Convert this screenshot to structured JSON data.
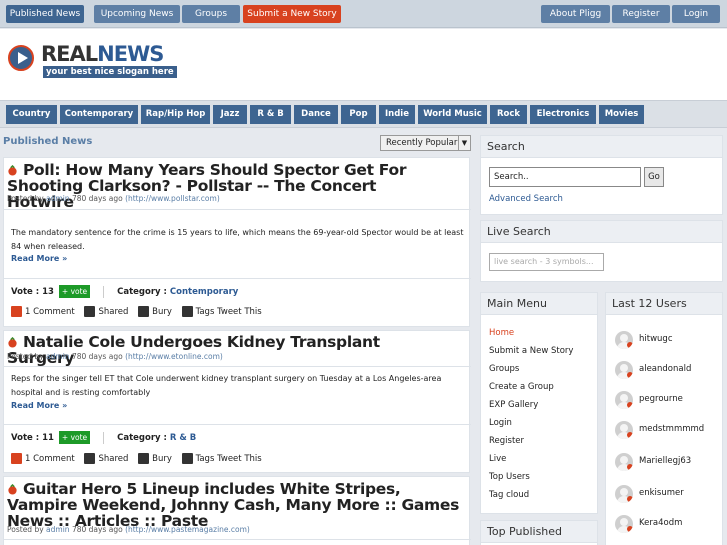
{
  "topnav": {
    "left": [
      "Published News",
      "Upcoming News",
      "Groups",
      "Submit a New Story"
    ],
    "right": [
      "About Pligg",
      "Register",
      "Login"
    ]
  },
  "logo": {
    "real": "REAL",
    "news": "NEWS",
    "slogan": "your best nice slogan here"
  },
  "categories": [
    "Country",
    "Contemporary",
    "Rap/Hip Hop",
    "Jazz",
    "R & B",
    "Dance",
    "Pop",
    "Indie",
    "World Music",
    "Rock",
    "Electronics",
    "Movies"
  ],
  "main": {
    "title": "Published News",
    "sort": "Recently Popular"
  },
  "stories": [
    {
      "title": "Poll: How Many Years Should Spector Get For Shooting Clarkson? - Pollstar -- The Concert Hotwire",
      "posted_by": "Posted by",
      "author": "admin",
      "age": "780 days ago",
      "source": "(http://www.pollstar.com)",
      "content": "The mandatory sentence for the crime is 15 years to life, which means the 69-year-old Spector would be at least 84 when released.",
      "readmore": "Read More »",
      "vote_label": "Vote :",
      "votes": "13",
      "vote_btn": "+ vote",
      "category_label": "Category :",
      "category": "Contemporary",
      "comments": "1 Comment",
      "shared": "Shared",
      "bury": "Bury",
      "tags": "Tags Tweet This"
    },
    {
      "title": "Natalie Cole Undergoes Kidney Transplant Surgery",
      "posted_by": "Posted by",
      "author": "admin",
      "age": "780 days ago",
      "source": "(http://www.etonline.com)",
      "content": "Reps for the singer tell ET that Cole underwent kidney transplant surgery on Tuesday at a Los Angeles-area hospital and is resting comfortably",
      "readmore": "Read More »",
      "vote_label": "Vote :",
      "votes": "11",
      "vote_btn": "+ vote",
      "category_label": "Category :",
      "category": "R & B",
      "comments": "1 Comment",
      "shared": "Shared",
      "bury": "Bury",
      "tags": "Tags Tweet This"
    },
    {
      "title": "Guitar Hero 5 Lineup includes White Stripes, Vampire Weekend, Johnny Cash, Many More :: Games News :: Articles :: Paste",
      "posted_by": "Posted by",
      "author": "admin",
      "age": "780 days ago",
      "source": "(http://www.pastemagazine.com)"
    }
  ],
  "sidebar": {
    "search": {
      "title": "Search",
      "placeholder": "Search..",
      "go": "Go",
      "advanced": "Advanced Search"
    },
    "live": {
      "title": "Live Search",
      "placeholder": "live search - 3 symbols..."
    },
    "menu": {
      "title": "Main Menu",
      "items": [
        "Home",
        "Submit a New Story",
        "Groups",
        "Create a Group",
        "EXP Gallery",
        "Login",
        "Register",
        "Live",
        "Top Users",
        "Tag cloud"
      ]
    },
    "users": {
      "title": "Last 12 Users",
      "items": [
        "hitwugc",
        "aleandonald",
        "pegrourne",
        "medstmmmmd",
        "Mariellegj63",
        "enkisumer",
        "Kera4odm"
      ]
    },
    "top_published": {
      "title": "Top Published"
    }
  },
  "colors": {
    "accent": "#3e6591",
    "red": "#d8421f",
    "vote": "#1d9a28"
  }
}
